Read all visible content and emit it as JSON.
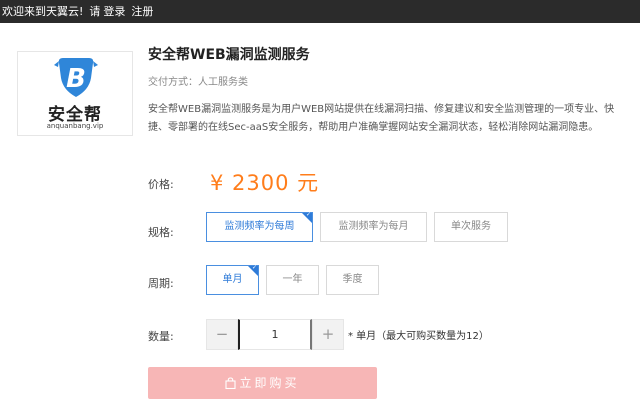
{
  "topbar": {
    "welcome": "欢迎来到天翼云!",
    "login_prompt": "请",
    "login": "登录",
    "register": "注册"
  },
  "product": {
    "logo_text": "安全帮",
    "logo_url": "anquanbang.vip",
    "logo_letter": "B",
    "title": "安全帮WEB漏洞监测服务",
    "delivery": "交付方式：人工服务类",
    "description": "安全帮WEB漏洞监测服务是为用户WEB网站提供在线漏洞扫描、修复建议和安全监测管理的一项专业、快捷、零部署的在线Sec-aaS安全服务，帮助用户准确掌握网站安全漏洞状态，轻松消除网站漏洞隐患。"
  },
  "price": {
    "label": "价格:",
    "value": "¥ 2300 元"
  },
  "spec": {
    "label": "规格:",
    "options": [
      "监测频率为每周",
      "监测频率为每月",
      "单次服务"
    ],
    "selected": 0
  },
  "period": {
    "label": "周期:",
    "options": [
      "单月",
      "一年",
      "季度"
    ],
    "selected": 0
  },
  "quantity": {
    "label": "数量:",
    "minus": "−",
    "plus": "+",
    "value": "1",
    "note": "* 单月（最大可购买数量为12）"
  },
  "buy_button": {
    "label": "立即购买",
    "icon": "shopping-bag-icon"
  },
  "colors": {
    "accent": "#2f7bd8",
    "price": "#ff7d1b",
    "buy": "#f7b6b6",
    "topbar": "#2b2b2b"
  }
}
